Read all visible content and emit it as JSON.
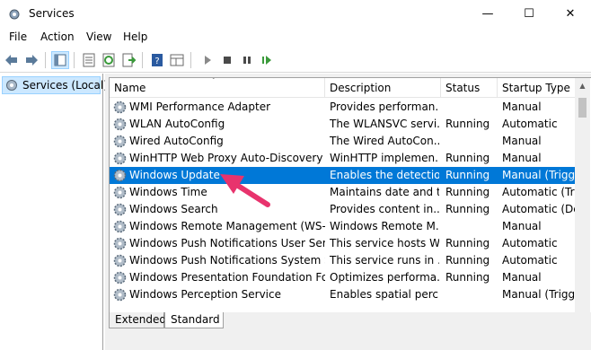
{
  "window": {
    "title": "Services"
  },
  "menu": [
    "File",
    "Action",
    "View",
    "Help"
  ],
  "tree": {
    "label": "Services (Local)"
  },
  "columns": [
    "Name",
    "Description",
    "Status",
    "Startup Type"
  ],
  "rows": [
    {
      "name": "WMI Performance Adapter",
      "desc": "Provides performan...",
      "status": "",
      "startup": "Manual",
      "selected": false
    },
    {
      "name": "WLAN AutoConfig",
      "desc": "The WLANSVC servi...",
      "status": "Running",
      "startup": "Automatic",
      "selected": false
    },
    {
      "name": "Wired AutoConfig",
      "desc": "The Wired AutoCon...",
      "status": "",
      "startup": "Manual",
      "selected": false
    },
    {
      "name": "WinHTTP Web Proxy Auto-Discovery S...",
      "desc": "WinHTTP implemen...",
      "status": "Running",
      "startup": "Manual",
      "selected": false
    },
    {
      "name": "Windows Update",
      "desc": "Enables the detectio...",
      "status": "Running",
      "startup": "Manual (Trigge",
      "selected": true
    },
    {
      "name": "Windows Time",
      "desc": "Maintains date and t...",
      "status": "Running",
      "startup": "Automatic (Trig",
      "selected": false
    },
    {
      "name": "Windows Search",
      "desc": "Provides content in...",
      "status": "Running",
      "startup": "Automatic (Del",
      "selected": false
    },
    {
      "name": "Windows Remote Management (WS-...",
      "desc": "Windows Remote M...",
      "status": "",
      "startup": "Manual",
      "selected": false
    },
    {
      "name": "Windows Push Notifications User Servi...",
      "desc": "This service hosts W...",
      "status": "Running",
      "startup": "Automatic",
      "selected": false
    },
    {
      "name": "Windows Push Notifications System Se...",
      "desc": "This service runs in ...",
      "status": "Running",
      "startup": "Automatic",
      "selected": false
    },
    {
      "name": "Windows Presentation Foundation Fon...",
      "desc": "Optimizes performa...",
      "status": "Running",
      "startup": "Manual",
      "selected": false
    },
    {
      "name": "Windows Perception Service",
      "desc": "Enables spatial perc...",
      "status": "",
      "startup": "Manual (Trigge",
      "selected": false
    }
  ],
  "tabs": [
    "Extended",
    "Standard"
  ],
  "colors": {
    "selection": "#0078d7",
    "annotation_arrow": "#e8336d"
  },
  "icons": [
    "services-app-icon",
    "back-icon",
    "forward-icon",
    "console-tree-icon",
    "properties-icon",
    "refresh-icon",
    "export-icon",
    "help-icon",
    "mmc-view-icon",
    "start-icon",
    "stop-icon",
    "pause-icon",
    "resume-icon",
    "gear-icon"
  ]
}
